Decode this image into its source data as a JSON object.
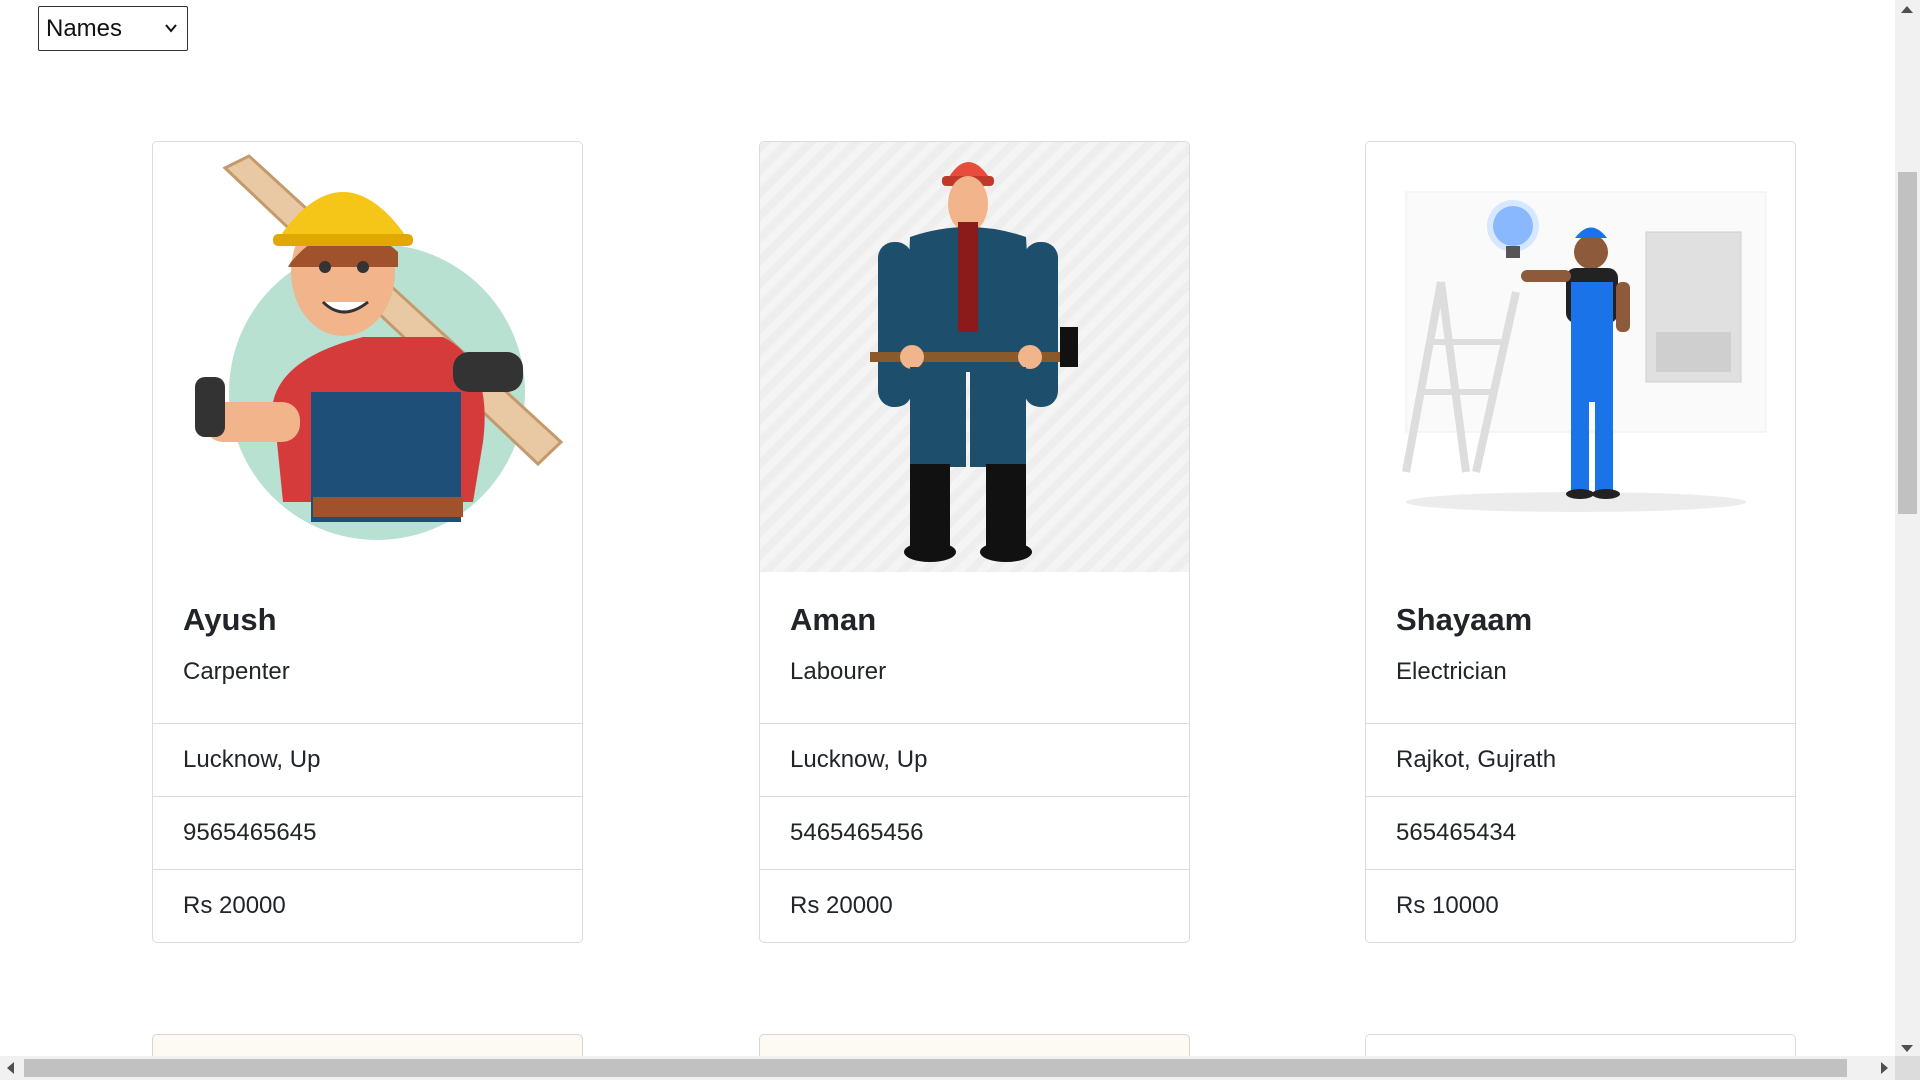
{
  "sort": {
    "selected": "Names"
  },
  "workers": [
    {
      "name": "Ayush",
      "role": "Carpenter",
      "location": "Lucknow, Up",
      "phone": "9565465645",
      "wage": "Rs 20000",
      "image": "carpenter-illustration"
    },
    {
      "name": "Aman",
      "role": "Labourer",
      "location": "Lucknow, Up",
      "phone": "5465465456",
      "wage": "Rs 20000",
      "image": "labourer-illustration"
    },
    {
      "name": "Shayaam",
      "role": "Electrician",
      "location": "Rajkot, Gujrath",
      "phone": "565465434",
      "wage": "Rs 10000",
      "image": "electrician-illustration"
    }
  ],
  "colors": {
    "helmet_yellow": "#f5c518",
    "helmet_red": "#e74c3c",
    "electrician_blue": "#1a73e8",
    "labourer_navy": "#1d4e6b"
  }
}
